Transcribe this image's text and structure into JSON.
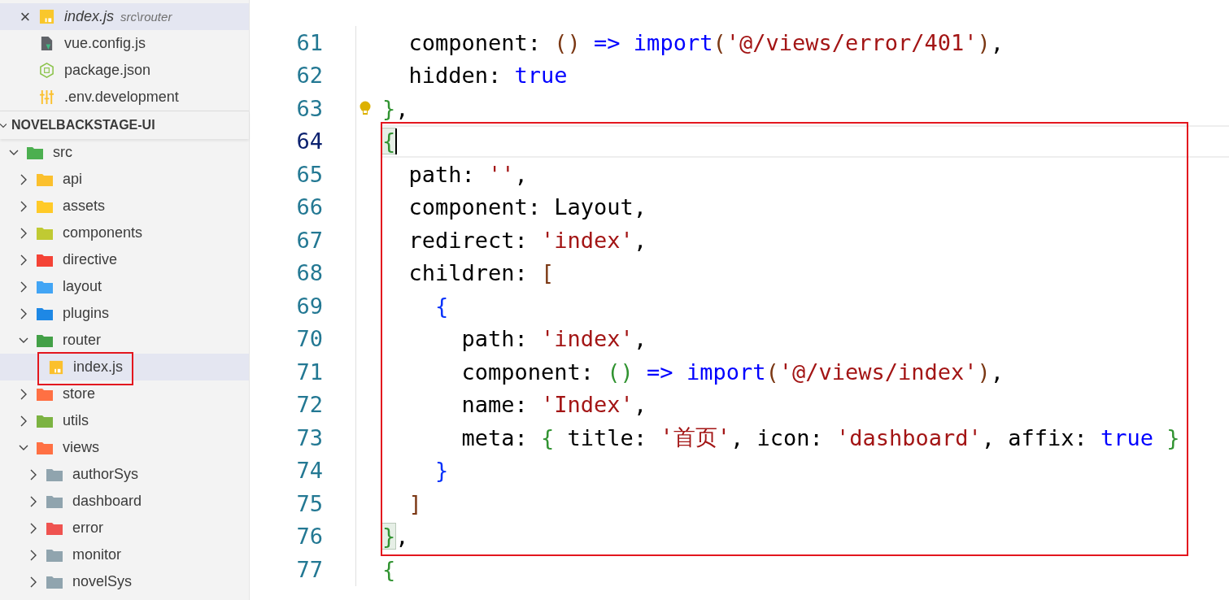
{
  "open_editors": [
    {
      "name": "index.js",
      "path": "src\\router",
      "close": "×",
      "kind": "js",
      "preview": true,
      "selected": true
    },
    {
      "name": "vue.config.js",
      "kind": "vue-config",
      "preview": false,
      "selected": false
    },
    {
      "name": "package.json",
      "kind": "json",
      "preview": false,
      "selected": false
    },
    {
      "name": ".env.development",
      "kind": "env",
      "preview": false,
      "selected": false
    }
  ],
  "explorer": {
    "title": "NOVELBACKSTAGE-UI",
    "expanded": true,
    "tree": [
      {
        "name": "src",
        "kind": "folder",
        "color": "#4caf50",
        "expanded": true,
        "selected": false,
        "children": [
          {
            "name": "api",
            "kind": "folder",
            "color": "#fbc02d",
            "expanded": false,
            "selected": false
          },
          {
            "name": "assets",
            "kind": "folder",
            "color": "#ffca28",
            "expanded": false,
            "selected": false
          },
          {
            "name": "components",
            "kind": "folder",
            "color": "#c0ca33",
            "expanded": false,
            "selected": false
          },
          {
            "name": "directive",
            "kind": "folder",
            "color": "#f44336",
            "expanded": false,
            "selected": false
          },
          {
            "name": "layout",
            "kind": "folder",
            "color": "#42a5f5",
            "expanded": false,
            "selected": false
          },
          {
            "name": "plugins",
            "kind": "folder",
            "color": "#1e88e5",
            "expanded": false,
            "selected": false
          },
          {
            "name": "router",
            "kind": "folder",
            "color": "#43a047",
            "expanded": true,
            "selected": false,
            "children": [
              {
                "name": "index.js",
                "kind": "file",
                "color": "#fbc02d",
                "selected": true,
                "boxed": true
              }
            ]
          },
          {
            "name": "store",
            "kind": "folder",
            "color": "#ff7043",
            "expanded": false,
            "selected": false
          },
          {
            "name": "utils",
            "kind": "folder",
            "color": "#7cb342",
            "expanded": false,
            "selected": false
          },
          {
            "name": "views",
            "kind": "folder",
            "color": "#ff7043",
            "expanded": true,
            "selected": false,
            "children": [
              {
                "name": "authorSys",
                "kind": "folder",
                "color": "#90a4ae",
                "expanded": false,
                "selected": false
              },
              {
                "name": "dashboard",
                "kind": "folder",
                "color": "#90a4ae",
                "expanded": false,
                "selected": false
              },
              {
                "name": "error",
                "kind": "folder",
                "color": "#ef5350",
                "expanded": false,
                "selected": false
              },
              {
                "name": "monitor",
                "kind": "folder",
                "color": "#90a4ae",
                "expanded": false,
                "selected": false
              },
              {
                "name": "novelSys",
                "kind": "folder",
                "color": "#90a4ae",
                "expanded": false,
                "selected": false
              }
            ]
          }
        ]
      }
    ]
  },
  "editor": {
    "blocks": [
      {
        "boxed": false,
        "lines": [
          {
            "number": "61",
            "current": false,
            "lightbulb": false,
            "tokens": [
              {
                "text": "  component: ",
                "kind": "plain"
              },
              {
                "text": "()",
                "kind": "bracket3"
              },
              {
                "text": " => import",
                "kind": "keyword"
              },
              {
                "text": "(",
                "kind": "bracket3"
              },
              {
                "text": "'@/views/error/401'",
                "kind": "string"
              },
              {
                "text": ")",
                "kind": "bracket3"
              },
              {
                "text": ",",
                "kind": "plain"
              }
            ]
          },
          {
            "number": "62",
            "current": false,
            "lightbulb": false,
            "tokens": [
              {
                "text": "  hidden: ",
                "kind": "plain"
              },
              {
                "text": "true",
                "kind": "keyword"
              }
            ]
          },
          {
            "number": "63",
            "current": false,
            "lightbulb": true,
            "tokens": [
              {
                "text": "}",
                "kind": "bracket1"
              },
              {
                "text": ",",
                "kind": "plain"
              }
            ]
          }
        ]
      },
      {
        "boxed": true,
        "lines": [
          {
            "number": "64",
            "current": true,
            "lightbulb": false,
            "tokens": [
              {
                "text": "{",
                "kind": "bracket1",
                "matched": true
              }
            ]
          },
          {
            "number": "65",
            "current": false,
            "lightbulb": false,
            "tokens": [
              {
                "text": "  path: ",
                "kind": "plain"
              },
              {
                "text": "''",
                "kind": "string"
              },
              {
                "text": ",",
                "kind": "plain"
              }
            ]
          },
          {
            "number": "66",
            "current": false,
            "lightbulb": false,
            "tokens": [
              {
                "text": "  component: Layout,",
                "kind": "plain"
              }
            ]
          },
          {
            "number": "67",
            "current": false,
            "lightbulb": false,
            "tokens": [
              {
                "text": "  redirect: ",
                "kind": "plain"
              },
              {
                "text": "'index'",
                "kind": "string"
              },
              {
                "text": ",",
                "kind": "plain"
              }
            ]
          },
          {
            "number": "68",
            "current": false,
            "lightbulb": false,
            "tokens": [
              {
                "text": "  children: ",
                "kind": "plain"
              },
              {
                "text": "[",
                "kind": "bracket3"
              }
            ]
          },
          {
            "number": "69",
            "current": false,
            "lightbulb": false,
            "tokens": [
              {
                "text": "    {",
                "kind": "bracket2"
              }
            ]
          },
          {
            "number": "70",
            "current": false,
            "lightbulb": false,
            "tokens": [
              {
                "text": "      path: ",
                "kind": "plain"
              },
              {
                "text": "'index'",
                "kind": "string"
              },
              {
                "text": ",",
                "kind": "plain"
              }
            ]
          },
          {
            "number": "71",
            "current": false,
            "lightbulb": false,
            "tokens": [
              {
                "text": "      component: ",
                "kind": "plain"
              },
              {
                "text": "()",
                "kind": "bracket1"
              },
              {
                "text": " => import",
                "kind": "keyword"
              },
              {
                "text": "(",
                "kind": "bracket3"
              },
              {
                "text": "'@/views/index'",
                "kind": "string"
              },
              {
                "text": ")",
                "kind": "bracket3"
              },
              {
                "text": ",",
                "kind": "plain"
              }
            ]
          },
          {
            "number": "72",
            "current": false,
            "lightbulb": false,
            "tokens": [
              {
                "text": "      name: ",
                "kind": "plain"
              },
              {
                "text": "'Index'",
                "kind": "string"
              },
              {
                "text": ",",
                "kind": "plain"
              }
            ]
          },
          {
            "number": "73",
            "current": false,
            "lightbulb": false,
            "tokens": [
              {
                "text": "      meta: ",
                "kind": "plain"
              },
              {
                "text": "{",
                "kind": "bracket1"
              },
              {
                "text": " title: ",
                "kind": "plain"
              },
              {
                "text": "'首页'",
                "kind": "string"
              },
              {
                "text": ", icon: ",
                "kind": "plain"
              },
              {
                "text": "'dashboard'",
                "kind": "string"
              },
              {
                "text": ", affix: ",
                "kind": "plain"
              },
              {
                "text": "true",
                "kind": "keyword"
              },
              {
                "text": " }",
                "kind": "bracket1"
              }
            ]
          },
          {
            "number": "74",
            "current": false,
            "lightbulb": false,
            "tokens": [
              {
                "text": "    }",
                "kind": "bracket2"
              }
            ]
          },
          {
            "number": "75",
            "current": false,
            "lightbulb": false,
            "tokens": [
              {
                "text": "  ]",
                "kind": "bracket3"
              }
            ]
          },
          {
            "number": "76",
            "current": false,
            "lightbulb": false,
            "tokens": [
              {
                "text": "}",
                "kind": "bracket1",
                "matched": true
              },
              {
                "text": ",",
                "kind": "plain"
              }
            ]
          }
        ]
      },
      {
        "boxed": false,
        "lines": [
          {
            "number": "77",
            "current": false,
            "lightbulb": false,
            "tokens": [
              {
                "text": "{",
                "kind": "bracket1"
              }
            ]
          }
        ]
      }
    ]
  }
}
